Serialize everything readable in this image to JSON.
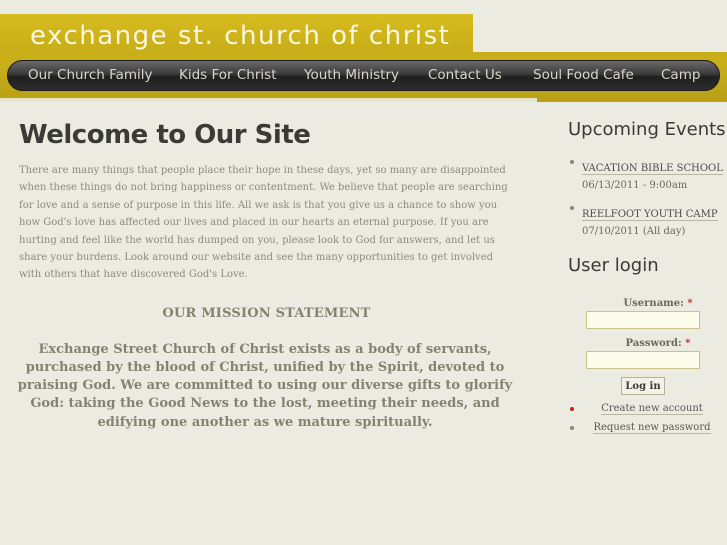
{
  "site": {
    "title": "exchange st. church of christ"
  },
  "nav": {
    "items": [
      "Our Church Family",
      "Kids For Christ",
      "Youth Ministry",
      "Contact Us",
      "Soul Food Cafe",
      "Camp"
    ]
  },
  "main": {
    "title": "Welcome to Our Site",
    "intro": "There are many things that people place their hope in these days, yet so many are disappointed when these things do not bring happiness or contentment.  We believe that people are searching for love and a sense of purpose in this life. All we ask is that you give us a chance to show you how God's love has affected our lives and placed in our hearts an eternal purpose. If you are hurting and feel like the world has dumped on you, please look to God for answers, and let us share your burdens. Look around our website and see the many opportunities to get involved with others that have discovered God's Love.",
    "mission_heading": "OUR MISSION STATEMENT",
    "mission_text": "Exchange Street Church of Christ exists as a body of servants, purchased by the blood of Christ, unified by the Spirit, devoted to praising God.  We are committed to using our diverse gifts to glorify God: taking the Good News to the lost, meeting their needs, and edifying one another as we mature spiritually."
  },
  "sidebar": {
    "events_title": "Upcoming Events",
    "events": [
      {
        "title": "VACATION BIBLE SCHOOL",
        "date": "06/13/2011 - 9:00am"
      },
      {
        "title": "REELFOOT YOUTH CAMP",
        "date": "07/10/2011 (All day)"
      }
    ],
    "login_title": "User login",
    "username_label": "Username:",
    "password_label": "Password:",
    "required_mark": "*",
    "login_button": "Log in",
    "links": [
      "Create new account",
      "Request new password"
    ],
    "link_bullet_colors": [
      "#cc2222",
      "#8a877a"
    ]
  }
}
